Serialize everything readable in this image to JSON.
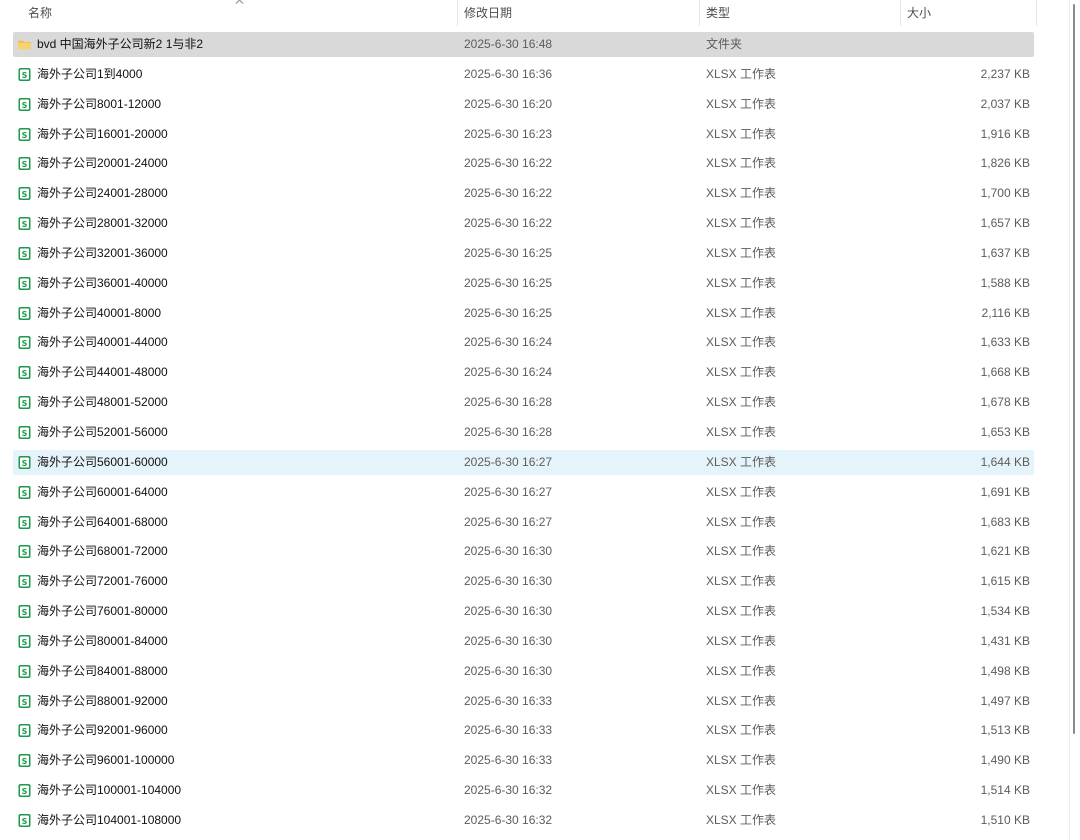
{
  "columns": {
    "name": "名称",
    "date": "修改日期",
    "type": "类型",
    "size": "大小"
  },
  "colors": {
    "selected": "#d9d9d9",
    "hover": "#e5f3fb",
    "folder": "#f2c14e",
    "excel": "#1e9a4f"
  },
  "files": [
    {
      "name": "bvd 中国海外子公司新2 1与非2",
      "date": "2025-6-30 16:48",
      "type": "文件夹",
      "size": "",
      "icon": "folder-icon",
      "state": "selected"
    },
    {
      "name": "海外子公司1到4000",
      "date": "2025-6-30 16:36",
      "type": "XLSX 工作表",
      "size": "2,237 KB",
      "icon": "spreadsheet-icon",
      "state": ""
    },
    {
      "name": "海外子公司8001-12000",
      "date": "2025-6-30 16:20",
      "type": "XLSX 工作表",
      "size": "2,037 KB",
      "icon": "spreadsheet-icon",
      "state": ""
    },
    {
      "name": "海外子公司16001-20000",
      "date": "2025-6-30 16:23",
      "type": "XLSX 工作表",
      "size": "1,916 KB",
      "icon": "spreadsheet-icon",
      "state": ""
    },
    {
      "name": "海外子公司20001-24000",
      "date": "2025-6-30 16:22",
      "type": "XLSX 工作表",
      "size": "1,826 KB",
      "icon": "spreadsheet-icon",
      "state": ""
    },
    {
      "name": "海外子公司24001-28000",
      "date": "2025-6-30 16:22",
      "type": "XLSX 工作表",
      "size": "1,700 KB",
      "icon": "spreadsheet-icon",
      "state": ""
    },
    {
      "name": "海外子公司28001-32000",
      "date": "2025-6-30 16:22",
      "type": "XLSX 工作表",
      "size": "1,657 KB",
      "icon": "spreadsheet-icon",
      "state": ""
    },
    {
      "name": "海外子公司32001-36000",
      "date": "2025-6-30 16:25",
      "type": "XLSX 工作表",
      "size": "1,637 KB",
      "icon": "spreadsheet-icon",
      "state": ""
    },
    {
      "name": "海外子公司36001-40000",
      "date": "2025-6-30 16:25",
      "type": "XLSX 工作表",
      "size": "1,588 KB",
      "icon": "spreadsheet-icon",
      "state": ""
    },
    {
      "name": "海外子公司40001-8000",
      "date": "2025-6-30 16:25",
      "type": "XLSX 工作表",
      "size": "2,116 KB",
      "icon": "spreadsheet-icon",
      "state": ""
    },
    {
      "name": "海外子公司40001-44000",
      "date": "2025-6-30 16:24",
      "type": "XLSX 工作表",
      "size": "1,633 KB",
      "icon": "spreadsheet-icon",
      "state": ""
    },
    {
      "name": "海外子公司44001-48000",
      "date": "2025-6-30 16:24",
      "type": "XLSX 工作表",
      "size": "1,668 KB",
      "icon": "spreadsheet-icon",
      "state": ""
    },
    {
      "name": "海外子公司48001-52000",
      "date": "2025-6-30 16:28",
      "type": "XLSX 工作表",
      "size": "1,678 KB",
      "icon": "spreadsheet-icon",
      "state": ""
    },
    {
      "name": "海外子公司52001-56000",
      "date": "2025-6-30 16:28",
      "type": "XLSX 工作表",
      "size": "1,653 KB",
      "icon": "spreadsheet-icon",
      "state": ""
    },
    {
      "name": "海外子公司56001-60000",
      "date": "2025-6-30 16:27",
      "type": "XLSX 工作表",
      "size": "1,644 KB",
      "icon": "spreadsheet-icon",
      "state": "hover"
    },
    {
      "name": "海外子公司60001-64000",
      "date": "2025-6-30 16:27",
      "type": "XLSX 工作表",
      "size": "1,691 KB",
      "icon": "spreadsheet-icon",
      "state": ""
    },
    {
      "name": "海外子公司64001-68000",
      "date": "2025-6-30 16:27",
      "type": "XLSX 工作表",
      "size": "1,683 KB",
      "icon": "spreadsheet-icon",
      "state": ""
    },
    {
      "name": "海外子公司68001-72000",
      "date": "2025-6-30 16:30",
      "type": "XLSX 工作表",
      "size": "1,621 KB",
      "icon": "spreadsheet-icon",
      "state": ""
    },
    {
      "name": "海外子公司72001-76000",
      "date": "2025-6-30 16:30",
      "type": "XLSX 工作表",
      "size": "1,615 KB",
      "icon": "spreadsheet-icon",
      "state": ""
    },
    {
      "name": "海外子公司76001-80000",
      "date": "2025-6-30 16:30",
      "type": "XLSX 工作表",
      "size": "1,534 KB",
      "icon": "spreadsheet-icon",
      "state": ""
    },
    {
      "name": "海外子公司80001-84000",
      "date": "2025-6-30 16:30",
      "type": "XLSX 工作表",
      "size": "1,431 KB",
      "icon": "spreadsheet-icon",
      "state": ""
    },
    {
      "name": "海外子公司84001-88000",
      "date": "2025-6-30 16:30",
      "type": "XLSX 工作表",
      "size": "1,498 KB",
      "icon": "spreadsheet-icon",
      "state": ""
    },
    {
      "name": "海外子公司88001-92000",
      "date": "2025-6-30 16:33",
      "type": "XLSX 工作表",
      "size": "1,497 KB",
      "icon": "spreadsheet-icon",
      "state": ""
    },
    {
      "name": "海外子公司92001-96000",
      "date": "2025-6-30 16:33",
      "type": "XLSX 工作表",
      "size": "1,513 KB",
      "icon": "spreadsheet-icon",
      "state": ""
    },
    {
      "name": "海外子公司96001-100000",
      "date": "2025-6-30 16:33",
      "type": "XLSX 工作表",
      "size": "1,490 KB",
      "icon": "spreadsheet-icon",
      "state": ""
    },
    {
      "name": "海外子公司100001-104000",
      "date": "2025-6-30 16:32",
      "type": "XLSX 工作表",
      "size": "1,514 KB",
      "icon": "spreadsheet-icon",
      "state": ""
    },
    {
      "name": "海外子公司104001-108000",
      "date": "2025-6-30 16:32",
      "type": "XLSX 工作表",
      "size": "1,510 KB",
      "icon": "spreadsheet-icon",
      "state": ""
    }
  ]
}
